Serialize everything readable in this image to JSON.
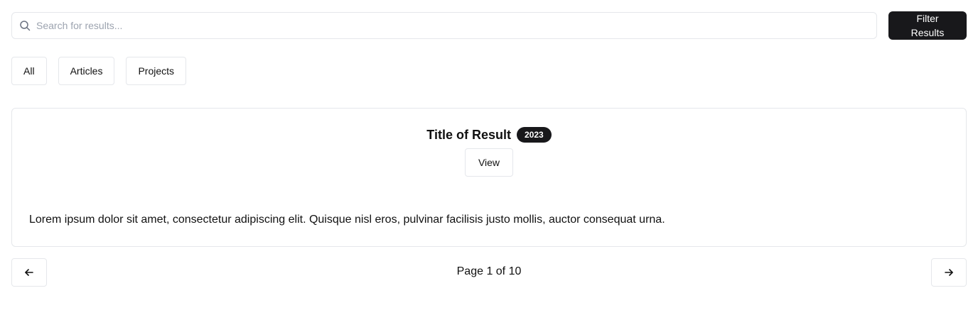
{
  "search": {
    "placeholder": "Search for results...",
    "value": "",
    "icon": "search-icon"
  },
  "filter": {
    "label": "Filter Results"
  },
  "tabs": [
    {
      "label": "All"
    },
    {
      "label": "Articles"
    },
    {
      "label": "Projects"
    }
  ],
  "result": {
    "title": "Title of Result",
    "year": "2023",
    "view_label": "View",
    "description": "Lorem ipsum dolor sit amet, consectetur adipiscing elit. Quisque nisl eros, pulvinar facilisis justo mollis, auctor consequat urna."
  },
  "pagination": {
    "label": "Page 1 of 10",
    "prev_icon": "arrow-left-icon",
    "next_icon": "arrow-right-icon"
  },
  "colors": {
    "primary": "#18181b",
    "border": "#e5e7eb",
    "placeholder": "#9ca3af"
  }
}
